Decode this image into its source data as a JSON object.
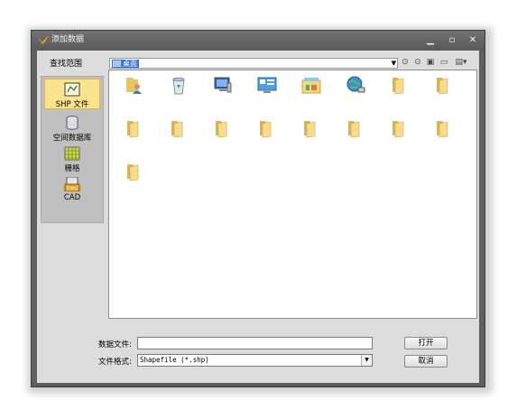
{
  "window": {
    "title": "添加数据",
    "min": "▁",
    "max": "▫",
    "close": "✕"
  },
  "lookin": {
    "label": "查找范围",
    "path": "桌面"
  },
  "sidebar": {
    "items": [
      {
        "label": "SHP 文件",
        "icon": "shapefile-icon",
        "selected": true
      },
      {
        "label": "空间数据库",
        "icon": "database-icon",
        "selected": false
      },
      {
        "label": "栅格",
        "icon": "raster-grid-icon",
        "selected": false
      },
      {
        "label": "CAD",
        "icon": "cad-dwg-icon",
        "selected": false
      }
    ]
  },
  "toolbar": {
    "back": "⊙",
    "up": "⊙",
    "recent": "▣",
    "new_folder": "▭",
    "view": "▤▾"
  },
  "files": [
    {
      "type": "user"
    },
    {
      "type": "recycle-bin"
    },
    {
      "type": "computer"
    },
    {
      "type": "control-panel"
    },
    {
      "type": "library"
    },
    {
      "type": "network"
    },
    {
      "type": "folder"
    },
    {
      "type": "folder"
    },
    {
      "type": "folder"
    },
    {
      "type": "folder"
    },
    {
      "type": "folder"
    },
    {
      "type": "folder"
    },
    {
      "type": "folder"
    },
    {
      "type": "folder"
    },
    {
      "type": "folder"
    },
    {
      "type": "folder"
    },
    {
      "type": "folder"
    }
  ],
  "form": {
    "file_label": "数据文件:",
    "file_value": "",
    "format_label": "文件格式:",
    "format_value": "Shapefile (*.shp)",
    "open_button": "打开",
    "cancel_button": "取消"
  },
  "colors": {
    "title_bg": "#5f5f5f",
    "selection": "#3873d8",
    "sidebar_selected": "#fbe38e",
    "folder": "#f2d27a"
  }
}
